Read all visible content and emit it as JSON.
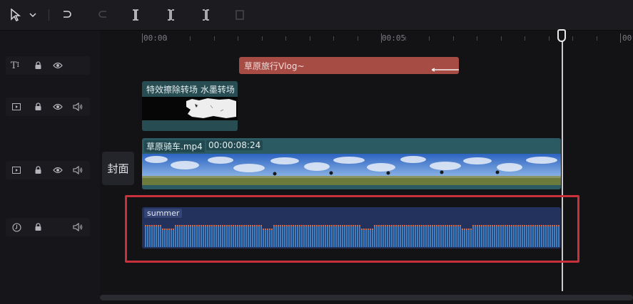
{
  "toolbar": {
    "icons": [
      "select-cursor-icon",
      "dropdown-chevron-icon",
      "undo-icon",
      "redo-icon",
      "split-icon",
      "split-left-icon",
      "split-right-icon",
      "delete-icon"
    ]
  },
  "ruler": {
    "labels": [
      "00:00",
      "00:05",
      "00"
    ]
  },
  "tracks": {
    "text": {
      "clip_label": "草原旅行Vlog~"
    },
    "effect": {
      "clip_label": "特效擦除转场 水墨转场"
    },
    "video": {
      "clip_label": "草原骑车.mp4",
      "duration": "00:00:08:24",
      "cover_label": "封面"
    },
    "audio": {
      "clip_label": "summer"
    }
  },
  "colors": {
    "text_clip": "#a74b45",
    "effect_clip": "#274c52",
    "video_clip": "#2c5a62",
    "audio_clip": "#23325d",
    "highlight": "#c8303b"
  }
}
